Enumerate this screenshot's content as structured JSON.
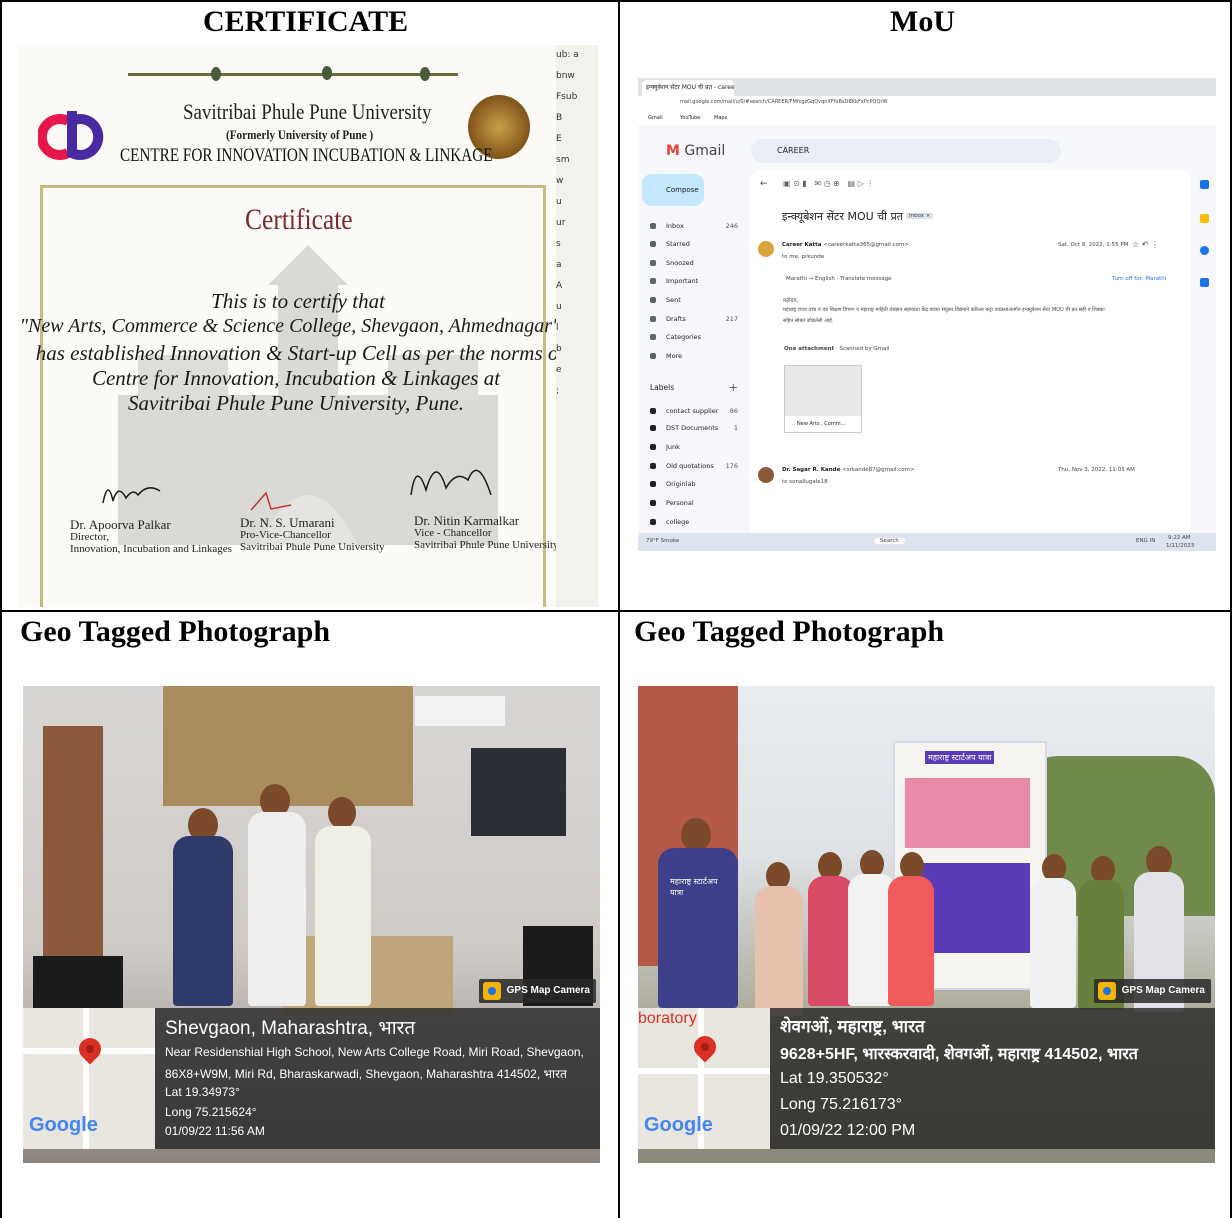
{
  "cells": {
    "certificate_title": "CERTIFICATE",
    "mou_title": "MoU",
    "geo1_title": "Geo Tagged Photograph",
    "geo2_title": "Geo Tagged Photograph"
  },
  "certificate": {
    "university": "Savitribai Phule Pune University",
    "formerly": "(Formerly University of Pune )",
    "centre": "CENTRE FOR INNOVATION INCUBATION & LINKAGE",
    "heading": "Certificate",
    "body_lines": [
      "This is to certify that",
      "\"New Arts, Commerce & Science College, Shevgaon, Ahmednagar\"",
      "has established Innovation & Start-up Cell as per the norms of",
      "Centre for Innovation, Incubation & Linkages at",
      "Savitribai Phule Pune University, Pune."
    ],
    "signatories": [
      {
        "name": "Dr. Apoorva Palkar",
        "role1": "Director,",
        "role2": "Innovation, Incubation and Linkages"
      },
      {
        "name": "Dr. N. S. Umarani",
        "role1": "Pro-Vice-Chancellor",
        "role2": "Savitribai Phule Pune University"
      },
      {
        "name": "Dr. Nitin Karmalkar",
        "role1": "Vice - Chancellor",
        "role2": "Savitribai Phule Pune University"
      }
    ]
  },
  "gmail": {
    "tab_title": "इन्क्युबेशन सेंटर MOU ची प्रत - career",
    "url": "mail.google.com/mail/u/0/#search/CAREER/FMfcgzGqQvqnXFfxBsDBKkFxPcPQQrW",
    "bookmarks": [
      "Gmail",
      "YouTube",
      "Maps"
    ],
    "app_name": "Gmail",
    "search_value": "CAREER",
    "compose_label": "Compose",
    "nav": [
      {
        "label": "Inbox",
        "count": "246"
      },
      {
        "label": "Starred",
        "count": ""
      },
      {
        "label": "Snoozed",
        "count": ""
      },
      {
        "label": "Important",
        "count": ""
      },
      {
        "label": "Sent",
        "count": ""
      },
      {
        "label": "Drafts",
        "count": "217"
      },
      {
        "label": "Categories",
        "count": ""
      },
      {
        "label": "More",
        "count": ""
      }
    ],
    "labels_heading": "Labels",
    "labels": [
      {
        "label": "contact supplier",
        "count": "86"
      },
      {
        "label": "DST Documents",
        "count": "1"
      },
      {
        "label": "Junk",
        "count": ""
      },
      {
        "label": "Old quotations",
        "count": "176"
      },
      {
        "label": "Originlab",
        "count": ""
      },
      {
        "label": "Personal",
        "count": ""
      },
      {
        "label": "college",
        "count": ""
      }
    ],
    "subject": "इन्क्यूबेशन सेंटर MOU ची प्रत",
    "inbox_chip": "Inbox ×",
    "msg1": {
      "sender": "Career Katta",
      "email": "<careerkatta365@gmail.com>",
      "to": "to me, prkunde",
      "date": "Sat, Oct 8, 2022, 1:55 PM",
      "translate": "Marathi → English · Translate message",
      "turn_off": "Turn off for: Marathi",
      "greeting": "महोदय,",
      "text_line1": "महाराष्ट्र राज्य उच्च व तंत्र शिक्षण विभाग व महाराष्ट्र माहिती तंत्रज्ञान सहाय्यता केंद्र यांच्या संयुक्त विद्यमाने करिअर कट्टा उपक्रमाअंतर्गत इन्क्यूबेशन सेंटर MOU ची प्रत सही व शिक्का",
      "text_line2": "सहित सोबत जोडलेली आहे.",
      "attachment_heading": "One attachment",
      "scanned": "Scanned by Gmail",
      "attachment_name": "New Arts , Comm..."
    },
    "msg2": {
      "sender": "Dr. Sagar R. Kande",
      "email": "<srkande87@gmail.com>",
      "to": "to sonallugale18",
      "date": "Thu, Nov 3, 2022, 11:03 AM"
    },
    "taskbar": {
      "weather": "79°F Smoke",
      "search": "Search",
      "lang": "ENG IN",
      "time": "9:22 AM",
      "date": "1/11/2023"
    }
  },
  "geo1": {
    "badge": "GPS Map Camera",
    "city": "Shevgaon, Maharashtra, भारत",
    "address1": "Near Residenshial High School, New Arts College Road, Miri Road, Shevgaon,",
    "address2": "86X8+W9M, Miri Rd, Bharaskarwadi, Shevgaon, Maharashtra 414502, भारत",
    "lat": "Lat 19.34973°",
    "long": "Long 75.215624°",
    "datetime": "01/09/22 11:56 AM",
    "google": "Google"
  },
  "geo2": {
    "badge": "GPS Map Camera",
    "map_text": "boratory",
    "city": "शेवगओं, महाराष्ट्र, भारत",
    "address1": "9628+5HF, भारस्करवादी, शेवगओं, महाराष्ट्र 414502, भारत",
    "lat": "Lat 19.350532°",
    "long": "Long 75.216173°",
    "datetime": "01/09/22 12:00 PM",
    "google": "Google",
    "shirt_text": "महाराष्ट्र स्टार्टअप यात्रा",
    "banner_text": "महाराष्ट्र स्टार्टअप यात्रा"
  }
}
